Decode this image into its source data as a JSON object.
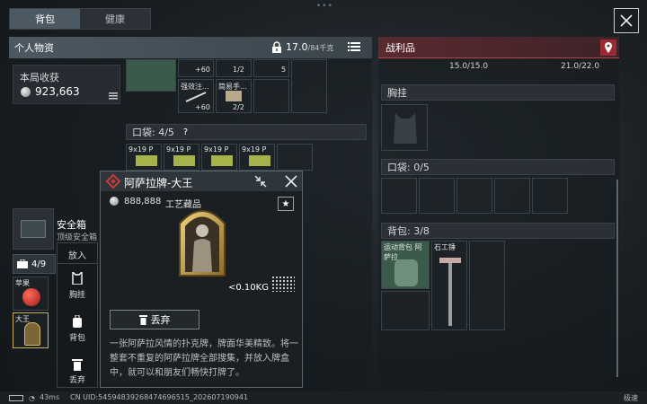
{
  "tabs": [
    {
      "label": "背包",
      "active": true
    },
    {
      "label": "健康",
      "active": false
    }
  ],
  "left_panel": {
    "title": "个人物资",
    "weight_current": "17.0",
    "weight_max": "/84千克"
  },
  "right_panel": {
    "title": "战利品",
    "top_weights": [
      "15.0/15.0",
      "21.0/22.0"
    ],
    "vest_label": "胸挂",
    "pocket_label": "口袋: 0/5",
    "backpack_label": "背包: 3/8",
    "backpack_items": [
      {
        "tag": "运动背包 阿萨拉"
      },
      {
        "tag": "石工锤"
      }
    ]
  },
  "income": {
    "label": "本局收获",
    "value": "923,663"
  },
  "rig_items": [
    {
      "tag": "+60",
      "count": ""
    },
    {
      "tag": "1/2",
      "count": ""
    },
    {
      "tag": "5",
      "count": ""
    },
    {
      "tag": "强效注...",
      "count": "+60"
    },
    {
      "tag": "简易手...",
      "count": "2/2"
    }
  ],
  "pocket": {
    "label": "口袋: 4/5",
    "help": "?",
    "items": [
      "9x19 P",
      "9x19 P",
      "9x19 P",
      "9x19 P"
    ]
  },
  "safe": {
    "name": "安全箱",
    "sub": "顶级安全箱",
    "bag_count": "4/9",
    "item1_tag": "苹果",
    "item2_tag": "大王"
  },
  "context_menu": {
    "put_in": "放入",
    "vest": "胸挂",
    "backpack": "背包",
    "discard": "丢弃"
  },
  "popup": {
    "title": "阿萨拉牌-大王",
    "price": "888,888",
    "type": "工艺藏品",
    "star": "★",
    "weight": "<0.10KG",
    "discard_label": "丢弃",
    "description": "一张阿萨拉风情的扑克牌，牌面华美精致。将一整套不重复的阿萨拉牌全部搜集，并放入牌盒中，就可以和朋友们畅快打牌了。"
  },
  "status": {
    "ping": "43ms",
    "uid": "CN UID:5459483926847469651​5_202607190941",
    "right": "极速"
  },
  "colors": {
    "accent_red": "#b0404a",
    "panel": "#4d5962",
    "item_green": "#3c5a49"
  }
}
